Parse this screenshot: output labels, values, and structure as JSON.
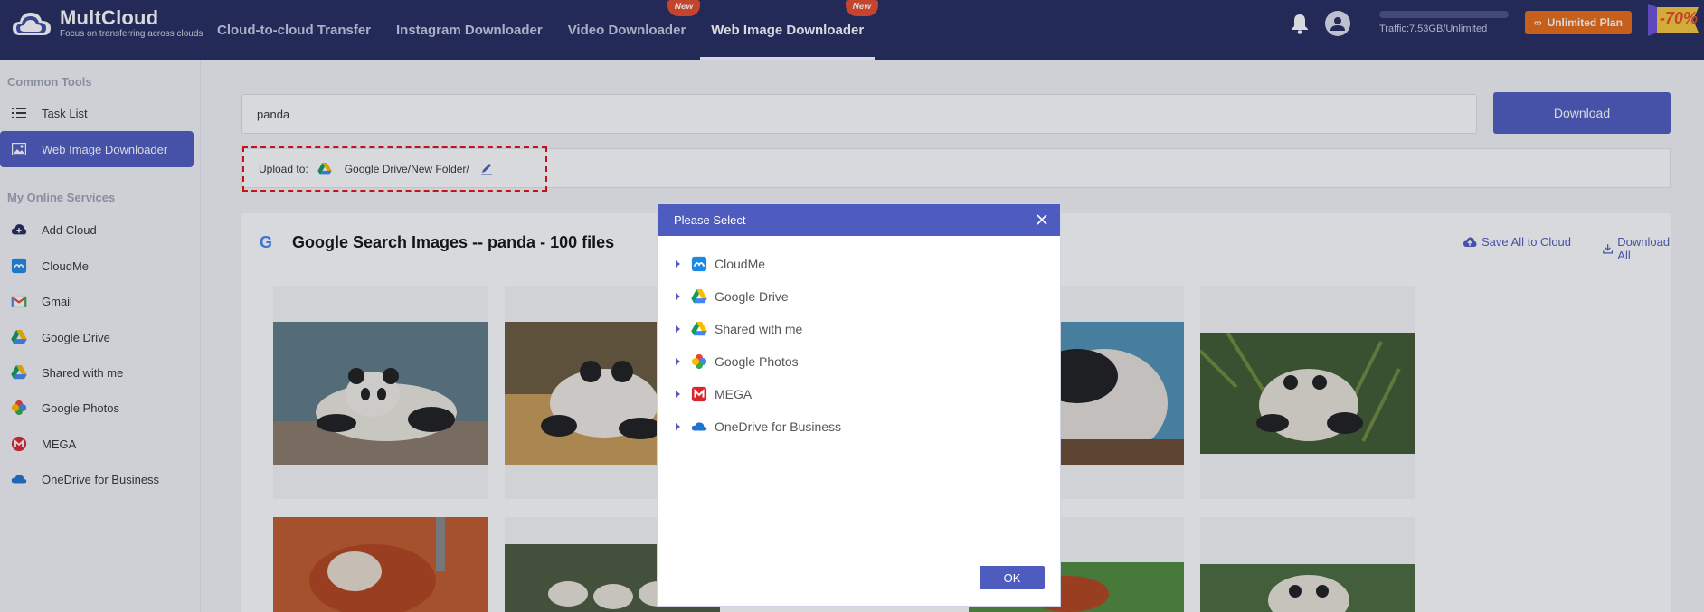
{
  "header": {
    "brand": "MultCloud",
    "tagline": "Focus on transferring across clouds",
    "nav": [
      {
        "label": "Cloud-to-cloud Transfer",
        "badge": ""
      },
      {
        "label": "Instagram Downloader",
        "badge": ""
      },
      {
        "label": "Video Downloader",
        "badge": "New"
      },
      {
        "label": "Web Image Downloader",
        "badge": "New"
      }
    ],
    "traffic": "Traffic:7.53GB/Unlimited",
    "plan_label": "Unlimited Plan",
    "promo": "-70%"
  },
  "sidebar": {
    "common_heading": "Common Tools",
    "common_items": [
      {
        "label": "Task List",
        "icon": "list-icon"
      },
      {
        "label": "Web Image Downloader",
        "icon": "image-icon"
      }
    ],
    "services_heading": "My Online Services",
    "services": [
      {
        "label": "Add Cloud",
        "icon": "add-cloud-icon"
      },
      {
        "label": "CloudMe",
        "icon": "cloudme-icon"
      },
      {
        "label": "Gmail",
        "icon": "gmail-icon"
      },
      {
        "label": "Google Drive",
        "icon": "google-drive-icon"
      },
      {
        "label": "Shared with me",
        "icon": "shared-drive-icon"
      },
      {
        "label": "Google Photos",
        "icon": "google-photos-icon"
      },
      {
        "label": "MEGA",
        "icon": "mega-icon"
      },
      {
        "label": "OneDrive for Business",
        "icon": "onedrive-icon"
      }
    ]
  },
  "main": {
    "search_value": "panda",
    "download_label": "Download",
    "upload_label": "Upload to:",
    "upload_path": "Google Drive/New Folder/",
    "results_title": "Google Search Images -- panda - 100 files",
    "save_all_label": "Save All to Cloud",
    "download_all_label": "Download All"
  },
  "modal": {
    "title": "Please Select",
    "items": [
      {
        "label": "CloudMe",
        "icon": "cloudme-icon"
      },
      {
        "label": "Google Drive",
        "icon": "google-drive-icon"
      },
      {
        "label": "Shared with me",
        "icon": "shared-drive-icon"
      },
      {
        "label": "Google Photos",
        "icon": "google-photos-icon"
      },
      {
        "label": "MEGA",
        "icon": "mega-icon"
      },
      {
        "label": "OneDrive for Business",
        "icon": "onedrive-icon"
      }
    ],
    "ok_label": "OK"
  },
  "colors": {
    "header_bg": "#232a5e",
    "accent": "#4e5bbf",
    "plan_orange": "#e86b13",
    "badge_red": "#e84a2b",
    "dashed_red": "#e30f0f"
  }
}
